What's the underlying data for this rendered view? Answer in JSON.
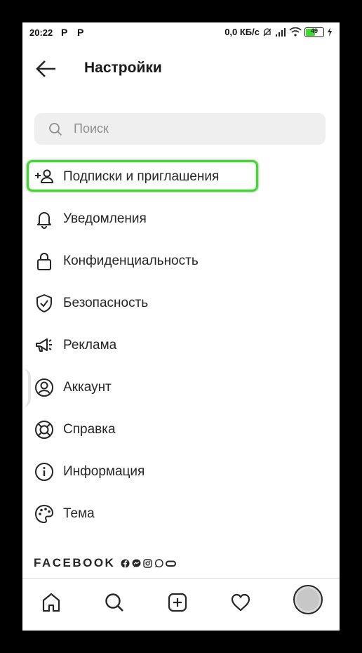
{
  "status_bar": {
    "time": "20:22",
    "notif1": "P",
    "notif2": "P",
    "speed": "0,0 КБ/с",
    "battery": "49"
  },
  "header": {
    "title": "Настройки"
  },
  "search": {
    "placeholder": "Поиск"
  },
  "menu": {
    "items": [
      {
        "label": "Подписки и приглашения",
        "icon": "add-person-icon"
      },
      {
        "label": "Уведомления",
        "icon": "bell-icon"
      },
      {
        "label": "Конфиденциальность",
        "icon": "lock-icon"
      },
      {
        "label": "Безопасность",
        "icon": "shield-check-icon"
      },
      {
        "label": "Реклама",
        "icon": "megaphone-icon"
      },
      {
        "label": "Аккаунт",
        "icon": "account-circle-icon"
      },
      {
        "label": "Справка",
        "icon": "lifebuoy-icon"
      },
      {
        "label": "Информация",
        "icon": "info-icon"
      },
      {
        "label": "Тема",
        "icon": "palette-icon"
      }
    ]
  },
  "footer": {
    "brand": "FACEBOOK"
  },
  "tabs": [
    "home-icon",
    "search-icon",
    "new-post-icon",
    "heart-icon",
    "profile-avatar"
  ],
  "colors": {
    "highlight": "#3ddc2a",
    "search_bg": "#efefef",
    "text": "#262626"
  }
}
